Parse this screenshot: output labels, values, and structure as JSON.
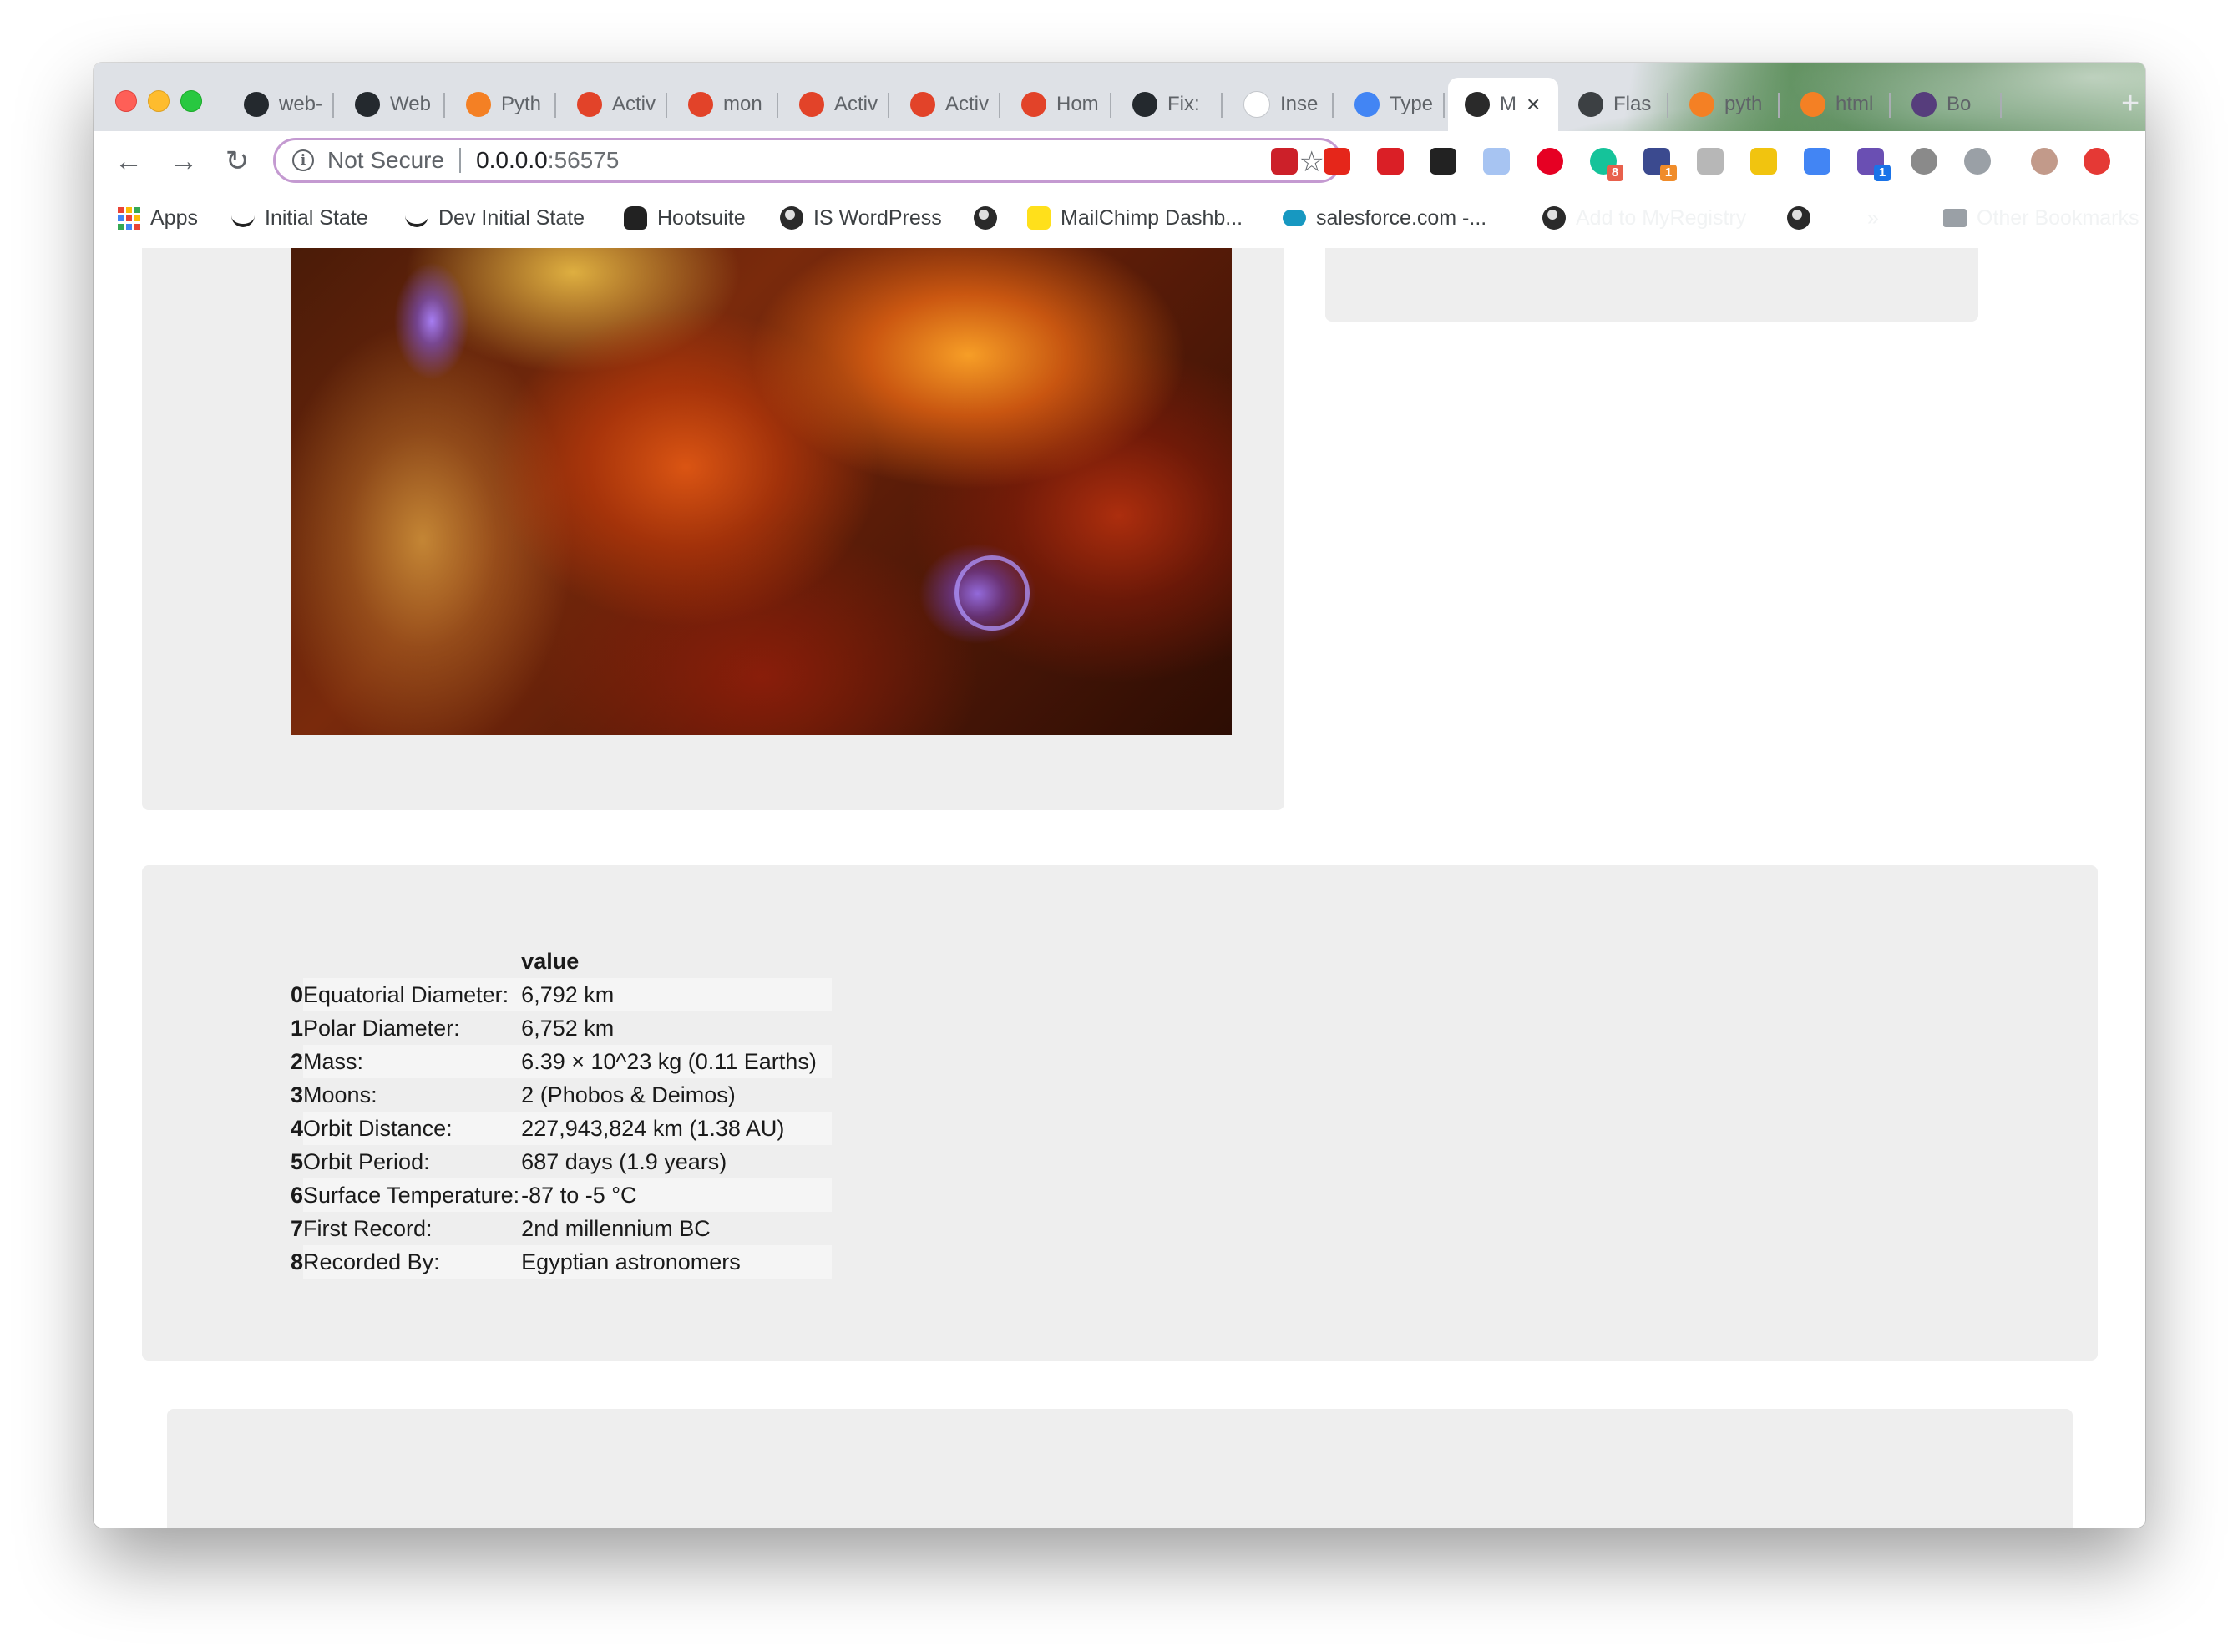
{
  "browser": {
    "tabs": [
      {
        "title": "web-",
        "icon": "github-icon",
        "color": "#24292e"
      },
      {
        "title": "Web",
        "icon": "github-icon",
        "color": "#24292e"
      },
      {
        "title": "Pyth",
        "icon": "stackoverflow-icon",
        "color": "#f48024"
      },
      {
        "title": "Activ",
        "icon": "gitlab-icon",
        "color": "#e24329"
      },
      {
        "title": "mon",
        "icon": "gitlab-icon",
        "color": "#e24329"
      },
      {
        "title": "Activ",
        "icon": "gitlab-icon",
        "color": "#e24329"
      },
      {
        "title": "Activ",
        "icon": "gitlab-icon",
        "color": "#e24329"
      },
      {
        "title": "Hom",
        "icon": "gitlab-icon",
        "color": "#e24329"
      },
      {
        "title": "Fix:",
        "icon": "github-icon",
        "color": "#24292e"
      },
      {
        "title": "Inse",
        "icon": "blank-page-icon",
        "color": "#ffffff"
      },
      {
        "title": "Type",
        "icon": "chat-icon",
        "color": "#4285f4"
      },
      {
        "title": "M",
        "icon": "globe-icon",
        "color": "#2a2a2a",
        "active": true
      },
      {
        "title": "Flas",
        "icon": "book-icon",
        "color": "#3c4043"
      },
      {
        "title": "pyth",
        "icon": "stackoverflow-icon",
        "color": "#f48024"
      },
      {
        "title": "html",
        "icon": "stackoverflow-icon",
        "color": "#f48024"
      },
      {
        "title": "Bo",
        "icon": "bootstrap-icon",
        "color": "#563d7c"
      }
    ],
    "omnibox": {
      "security_label": "Not Secure",
      "url_host": "0.0.0.0",
      "url_port": ":56575"
    },
    "extensions": [
      {
        "icon": "lastpass-icon",
        "color": "#cc2029",
        "badge": ""
      },
      {
        "icon": "adblock-icon",
        "color": "#e5261a",
        "badge": ""
      },
      {
        "icon": "creative-cloud-icon",
        "color": "#da1f26",
        "badge": ""
      },
      {
        "icon": "hootsuite-owl-icon",
        "color": "#222222",
        "badge": ""
      },
      {
        "icon": "window-icon",
        "color": "#a7c4f2",
        "badge": ""
      },
      {
        "icon": "pinterest-icon",
        "color": "#e60023",
        "badge": ""
      },
      {
        "icon": "grammarly-icon",
        "color": "#15c39a",
        "badge": "8"
      },
      {
        "icon": "pie-icon",
        "color": "#3b4a8f",
        "badge": "1"
      },
      {
        "icon": "evernote-icon",
        "color": "#b7b7b7",
        "badge": ""
      },
      {
        "icon": "e-icon",
        "color": "#f1c40f",
        "badge": ""
      },
      {
        "icon": "google-translate-icon",
        "color": "#4285f4",
        "badge": ""
      },
      {
        "icon": "feather-icon",
        "color": "#6a4fb3",
        "badge": "1"
      },
      {
        "icon": "dollar-icon",
        "color": "#8a8a8a",
        "badge": ""
      },
      {
        "icon": "refresh-circle-icon",
        "color": "#9aa0a6",
        "badge": ""
      },
      {
        "icon": "profile-avatar-icon",
        "color": "#c29a8a",
        "badge": ""
      },
      {
        "icon": "upload-icon",
        "color": "#e53935",
        "badge": ""
      }
    ],
    "bookmarks": [
      {
        "label": "Apps",
        "icon": "apps-grid-icon"
      },
      {
        "label": "Initial State",
        "icon": "initial-state-icon"
      },
      {
        "label": "Dev Initial State",
        "icon": "initial-state-icon"
      },
      {
        "label": "Hootsuite",
        "icon": "hootsuite-owl-icon"
      },
      {
        "label": "IS WordPress",
        "icon": "globe-icon"
      },
      {
        "label": "",
        "icon": "globe-icon"
      },
      {
        "label": "MailChimp Dashb...",
        "icon": "mailchimp-icon"
      },
      {
        "label": "salesforce.com -...",
        "icon": "salesforce-cloud-icon"
      },
      {
        "label": "Add to MyRegistry",
        "icon": "globe-icon"
      },
      {
        "label": "",
        "icon": "globe-icon"
      },
      {
        "label": "»",
        "icon": ""
      },
      {
        "label": "Other Bookmarks",
        "icon": "folder-icon"
      }
    ]
  },
  "table": {
    "header_value": "value",
    "rows": [
      {
        "index": "0",
        "key": "Equatorial Diameter:",
        "value": "6,792 km"
      },
      {
        "index": "1",
        "key": "Polar Diameter:",
        "value": "6,752 km"
      },
      {
        "index": "2",
        "key": "Mass:",
        "value": "6.39 × 10^23 kg (0.11 Earths)"
      },
      {
        "index": "3",
        "key": "Moons:",
        "value": "2 (Phobos & Deimos)"
      },
      {
        "index": "4",
        "key": "Orbit Distance:",
        "value": "227,943,824 km (1.38 AU)"
      },
      {
        "index": "5",
        "key": "Orbit Period:",
        "value": "687 days (1.9 years)"
      },
      {
        "index": "6",
        "key": "Surface Temperature:",
        "value": "-87 to -5 °C"
      },
      {
        "index": "7",
        "key": "First Record:",
        "value": "2nd millennium BC"
      },
      {
        "index": "8",
        "key": "Recorded By:",
        "value": "Egyptian astronomers"
      }
    ]
  }
}
